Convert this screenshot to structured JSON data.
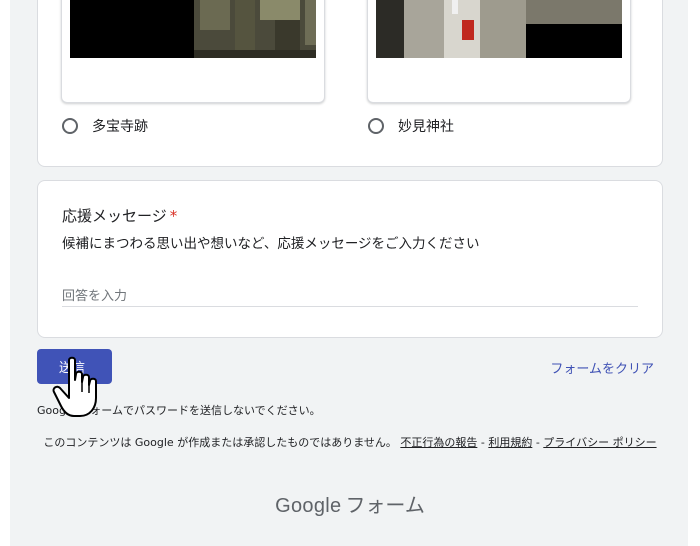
{
  "options": [
    {
      "label": "多宝寺跡"
    },
    {
      "label": "妙見神社"
    }
  ],
  "question": {
    "title": "応援メッセージ",
    "required_mark": "*",
    "description": "候補にまつわる思い出や想いなど、応援メッセージをご入力ください",
    "placeholder": "回答を入力"
  },
  "actions": {
    "submit_label": "送信",
    "clear_label": "フォームをクリア"
  },
  "footer": {
    "password_warning": "Google フォームでパスワードを送信しないでください。",
    "disclaimer_prefix": "このコンテンツは Google が作成または承認したものではありません。",
    "report_link": "不正行為の報告",
    "terms_link": "利用規約",
    "privacy_link": "プライバシー ポリシー",
    "separator": " - ",
    "brand_google": "Google",
    "brand_forms": "フォーム"
  },
  "colors": {
    "accent": "#4053b7",
    "required": "#d93025",
    "page_bg": "#f1f3f4"
  }
}
